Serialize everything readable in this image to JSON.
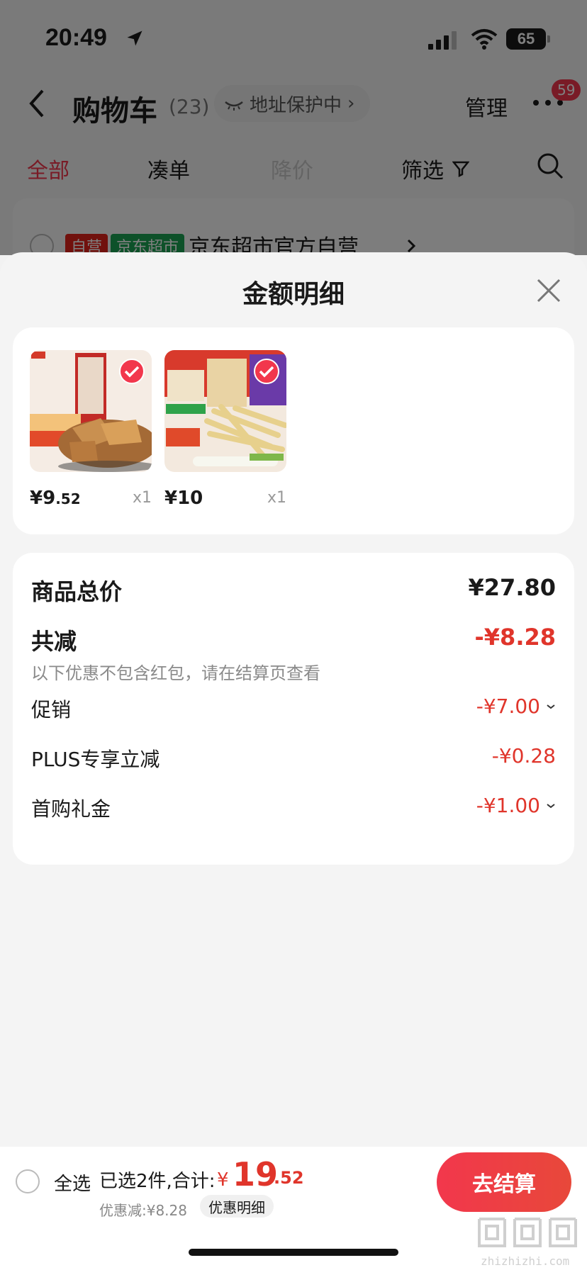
{
  "status_bar": {
    "time": "20:49",
    "battery": "65"
  },
  "header": {
    "title": "购物车",
    "count": "(23)",
    "address_pill": "地址保护中",
    "manage": "管理",
    "badge": "59"
  },
  "tabs": [
    {
      "label": "全部"
    },
    {
      "label": "凑单"
    },
    {
      "label": "降价"
    },
    {
      "label": "筛选"
    }
  ],
  "store": {
    "tag_self": "自营",
    "tag_market": "京东超市",
    "name": "京东超市官方自营"
  },
  "sheet": {
    "title": "金额明细",
    "products": [
      {
        "yen": "¥",
        "price_int": "9",
        "price_dec": ".52",
        "qty": "x1"
      },
      {
        "yen": "¥",
        "price_int": "10",
        "price_dec": "",
        "qty": "x1"
      }
    ],
    "summary": {
      "total_label": "商品总价",
      "total_value": "¥27.80",
      "reduce_label": "共减",
      "reduce_value": "-¥8.28",
      "note": "以下优惠不包含红包，请在结算页查看",
      "promo_label": "促销",
      "promo_value": "-¥7.00",
      "plus_label": "PLUS专享立减",
      "plus_value": "-¥0.28",
      "gift_label": "首购礼金",
      "gift_value": "-¥1.00"
    }
  },
  "bottom": {
    "select_all": "全选",
    "selected_info": "已选2件,合计:",
    "yen": "¥",
    "total_int": "19",
    "total_dec": ".52",
    "discount_text": "优惠减:¥8.28",
    "discount_detail": "优惠明细",
    "checkout": "去结算"
  },
  "watermark": {
    "url": "zhizhizhi.com"
  },
  "colors": {
    "accent": "#f2374c",
    "discount": "#e0352b",
    "green_tag": "#1aa352"
  }
}
